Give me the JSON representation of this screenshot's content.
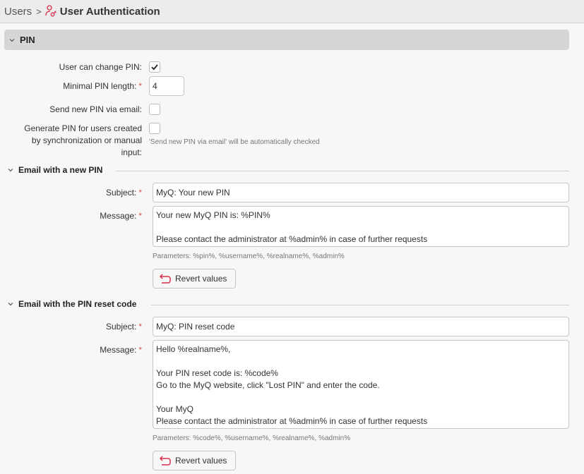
{
  "breadcrumb": {
    "parent": "Users",
    "separator": ">",
    "current": "User Authentication",
    "icon": "user-key-icon"
  },
  "colors": {
    "accent": "#d6304a",
    "required": "#d9534f",
    "section_bar": "#d6d6d6",
    "header_bg": "#ececec",
    "page_bg": "#f7f7f7"
  },
  "pin_section": {
    "title": "PIN",
    "user_can_change_pin": {
      "label": "User can change PIN:",
      "checked": true
    },
    "minimal_pin_length": {
      "label": "Minimal PIN length:",
      "required_mark": "*",
      "value": "4"
    },
    "send_new_pin_via_email": {
      "label": "Send new PIN via email:",
      "checked": false
    },
    "generate_pin": {
      "label_line1": "Generate PIN for users created",
      "label_line2": "by synchronization or manual",
      "label_line3": "input:",
      "checked": false,
      "hint": "'Send new PIN via email' will be automatically checked"
    }
  },
  "email_new_pin": {
    "title": "Email with a new PIN",
    "subject_label": "Subject:",
    "subject_value": "MyQ: Your new PIN",
    "message_label": "Message:",
    "message_value": "Your new MyQ PIN is: %PIN%\n\nPlease contact the administrator at %admin% in case of further requests",
    "required_mark": "*",
    "parameters": "Parameters: %pin%, %username%, %realname%, %admin%",
    "revert_label": "Revert values"
  },
  "email_reset_code": {
    "title": "Email with the PIN reset code",
    "subject_label": "Subject:",
    "subject_value": "MyQ: PIN reset code",
    "message_label": "Message:",
    "message_value": "Hello %realname%,\n\nYour PIN reset code is: %code%\nGo to the MyQ website, click \"Lost PIN\" and enter the code.\n\nYour MyQ\nPlease contact the administrator at %admin% in case of further requests",
    "required_mark": "*",
    "parameters": "Parameters: %code%, %username%, %realname%, %admin%",
    "revert_label": "Revert values"
  }
}
